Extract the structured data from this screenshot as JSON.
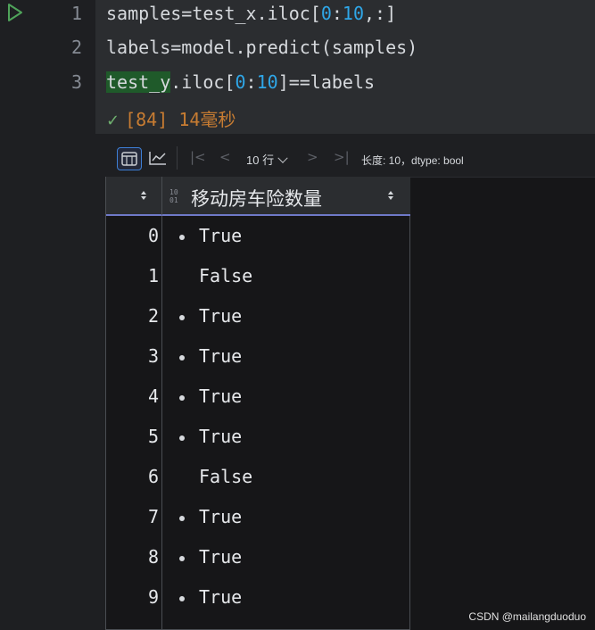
{
  "editor": {
    "line_numbers": [
      "1",
      "2",
      "3"
    ],
    "lines": {
      "l1_a": "samples=test_x.iloc[",
      "l1_b": "0",
      "l1_c": ":",
      "l1_d": "10",
      "l1_e": ",:]",
      "l2": "labels=model.predict(samples)",
      "l3_a": "test_y",
      "l3_b": ".iloc[",
      "l3_c": "0",
      "l3_d": ":",
      "l3_e": "10",
      "l3_f": "]==labels"
    },
    "execution": {
      "count": "[84]",
      "time": "14毫秒"
    }
  },
  "output": {
    "toolbar": {
      "rows_selector": "10 行",
      "info": "长度: 10，dtype: bool"
    },
    "table": {
      "column_type_icon": "10\n01",
      "column_name": "移动房车险数量",
      "rows": [
        {
          "index": "0",
          "value": "True",
          "marker": true
        },
        {
          "index": "1",
          "value": "False",
          "marker": false
        },
        {
          "index": "2",
          "value": "True",
          "marker": true
        },
        {
          "index": "3",
          "value": "True",
          "marker": true
        },
        {
          "index": "4",
          "value": "True",
          "marker": true
        },
        {
          "index": "5",
          "value": "True",
          "marker": true
        },
        {
          "index": "6",
          "value": "False",
          "marker": false
        },
        {
          "index": "7",
          "value": "True",
          "marker": true
        },
        {
          "index": "8",
          "value": "True",
          "marker": true
        },
        {
          "index": "9",
          "value": "True",
          "marker": true
        }
      ]
    }
  },
  "watermark": "CSDN @mailangduoduo",
  "colors": {
    "accent": "#3d7fd6",
    "number": "#2fa7e8",
    "exec_time": "#c77c32",
    "success": "#6fb06f"
  }
}
